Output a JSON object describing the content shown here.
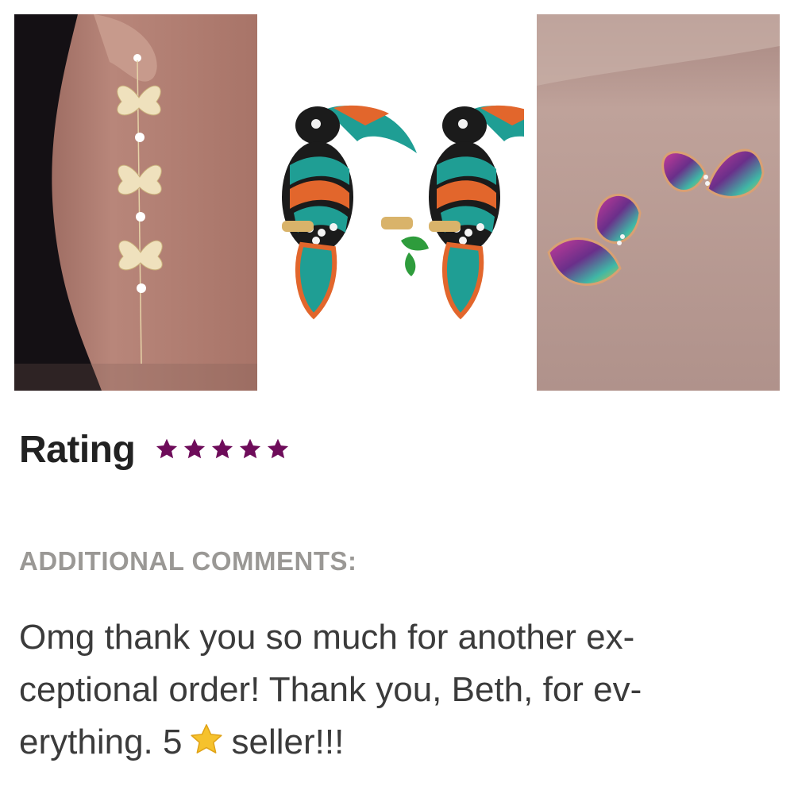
{
  "photos": [
    {
      "icon": "butterfly-drop-earring-photo",
      "palette": {
        "skin": "#b8867a",
        "hair": "#141014",
        "metal": "#e6d4a8"
      }
    },
    {
      "icon": "toucan-enamel-earrings-photo",
      "palette": {
        "teal": "#1f9e94",
        "orange": "#e2662c",
        "black": "#1b1b1b",
        "gold": "#d9b36a"
      }
    },
    {
      "icon": "crystal-butterfly-studs-photo",
      "palette": {
        "background": "#b0928b",
        "crystal_a": "#c93c9a",
        "crystal_b": "#3fb8a6"
      }
    }
  ],
  "rating": {
    "label": "Rating",
    "stars": 5,
    "max_stars": 5,
    "star_color": "#6e0c5a"
  },
  "comments": {
    "heading": "ADDITIONAL COMMENTS:",
    "lines": [
      "Omg thank you so much for another ex-",
      "ceptional order! Thank you, Beth, for ev-",
      "erything. 5"
    ],
    "line3_after_star": "seller!!!",
    "inline_icon": "star-emoji-icon",
    "inline_icon_color": "#f6c22d"
  }
}
